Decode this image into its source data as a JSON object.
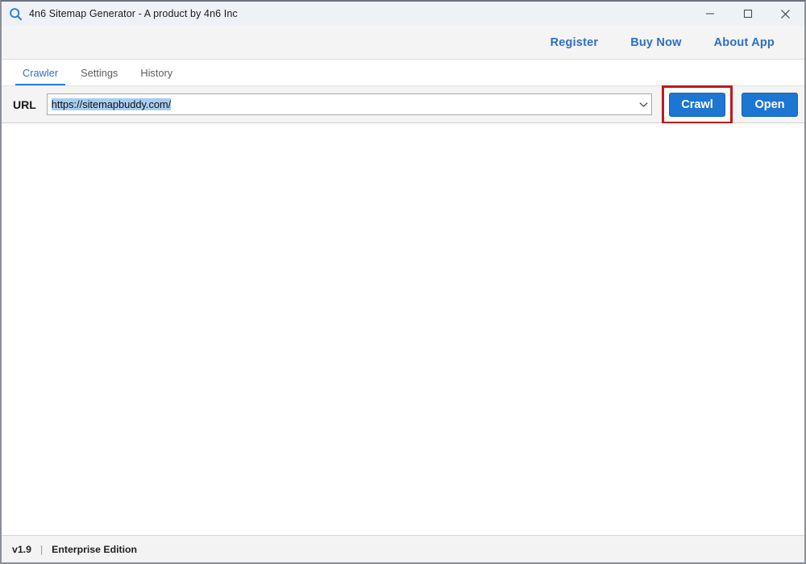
{
  "window": {
    "title": "4n6 Sitemap Generator - A product by 4n6 Inc",
    "app_icon": "magnifier-icon",
    "controls": {
      "minimize": "minimize-icon",
      "maximize": "maximize-icon",
      "close": "close-icon"
    }
  },
  "toolbar": {
    "links": [
      {
        "label": "Register",
        "name": "register-link"
      },
      {
        "label": "Buy Now",
        "name": "buy-now-link"
      },
      {
        "label": "About App",
        "name": "about-app-link"
      }
    ]
  },
  "tabs": [
    {
      "label": "Crawler",
      "active": true
    },
    {
      "label": "Settings",
      "active": false
    },
    {
      "label": "History",
      "active": false
    }
  ],
  "url_bar": {
    "label": "URL",
    "value": "https://sitemapbuddy.com/",
    "placeholder": "",
    "dropdown_icon": "chevron-down-icon",
    "crawl_label": "Crawl",
    "open_label": "Open",
    "highlight_color": "#c0191b",
    "button_color": "#1d76d2",
    "selection_color": "#a8cdf0"
  },
  "status_bar": {
    "version": "v1.9",
    "separator": "|",
    "edition": "Enterprise Edition"
  },
  "colors": {
    "accent_blue": "#2a6fc9",
    "tab_underline": "#2a7fd4",
    "annotation_red": "#c0191b"
  }
}
